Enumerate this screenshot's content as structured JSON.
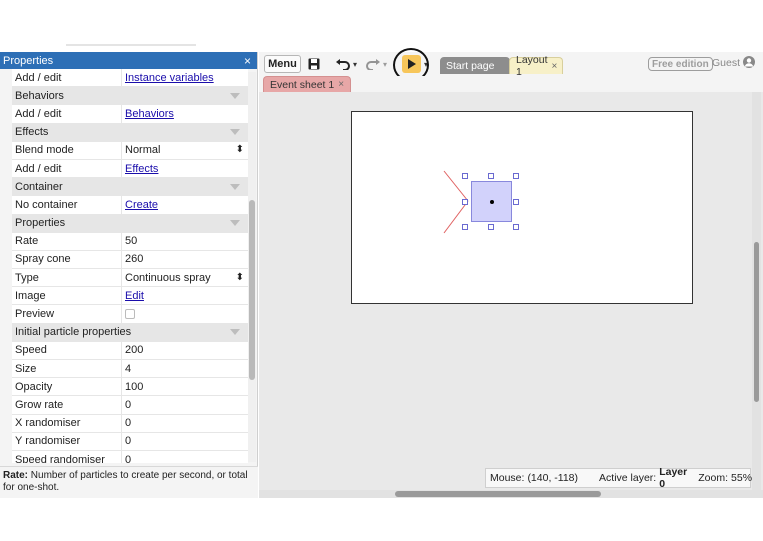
{
  "props_panel": {
    "title": "Properties",
    "close_glyph": "×",
    "rows": [
      {
        "kind": "row",
        "label": "Add / edit",
        "value": "Instance variables",
        "value_type": "link"
      },
      {
        "kind": "section",
        "label": "Behaviors"
      },
      {
        "kind": "row",
        "label": "Add / edit",
        "value": "Behaviors",
        "value_type": "link"
      },
      {
        "kind": "section",
        "label": "Effects"
      },
      {
        "kind": "row",
        "label": "Blend mode",
        "value": "Normal",
        "value_type": "select"
      },
      {
        "kind": "row",
        "label": "Add / edit",
        "value": "Effects",
        "value_type": "link"
      },
      {
        "kind": "section",
        "label": "Container"
      },
      {
        "kind": "row",
        "label": "No container",
        "value": "Create",
        "value_type": "link"
      },
      {
        "kind": "section",
        "label": "Properties"
      },
      {
        "kind": "row",
        "label": "Rate",
        "value": "50",
        "value_type": "text"
      },
      {
        "kind": "row",
        "label": "Spray cone",
        "value": "260",
        "value_type": "text"
      },
      {
        "kind": "row",
        "label": "Type",
        "value": "Continuous spray",
        "value_type": "select"
      },
      {
        "kind": "row",
        "label": "Image",
        "value": "Edit",
        "value_type": "link"
      },
      {
        "kind": "row",
        "label": "Preview",
        "value": "",
        "value_type": "checkbox"
      },
      {
        "kind": "section",
        "label": "Initial particle properties"
      },
      {
        "kind": "row",
        "label": "Speed",
        "value": "200",
        "value_type": "text"
      },
      {
        "kind": "row",
        "label": "Size",
        "value": "4",
        "value_type": "text"
      },
      {
        "kind": "row",
        "label": "Opacity",
        "value": "100",
        "value_type": "text"
      },
      {
        "kind": "row",
        "label": "Grow rate",
        "value": "0",
        "value_type": "text"
      },
      {
        "kind": "row",
        "label": "X randomiser",
        "value": "0",
        "value_type": "text"
      },
      {
        "kind": "row",
        "label": "Y randomiser",
        "value": "0",
        "value_type": "text"
      },
      {
        "kind": "row",
        "label": "Speed randomiser",
        "value": "0",
        "value_type": "text"
      }
    ],
    "description": {
      "term": "Rate:",
      "text": " Number of particles to create per second, or total for one-shot."
    }
  },
  "toolbar": {
    "menu_label": "Menu",
    "free_edition": "Free edition",
    "guest_label": "Guest",
    "tabs": [
      {
        "label": "Start page",
        "close": "×"
      },
      {
        "label": "Layout 1",
        "close": "×"
      }
    ],
    "subtabs": [
      {
        "label": "Event sheet 1",
        "close": "×"
      }
    ]
  },
  "status_bar": {
    "mouse_label": "Mouse:",
    "mouse_value": "(140, -118)",
    "layer_label": "Active layer:",
    "layer_value": "Layer 0",
    "zoom_label": "Zoom:",
    "zoom_value": "55%"
  },
  "colors": {
    "panel_header": "#2d6fb6",
    "play_button": "#f7c65a",
    "sprite_fill": "#d2d2fb",
    "cone_line": "#e06060"
  },
  "icons": [
    "close-icon",
    "save-icon",
    "undo-icon",
    "redo-icon",
    "play-icon",
    "user-icon",
    "dropdown-arrow-icon"
  ]
}
